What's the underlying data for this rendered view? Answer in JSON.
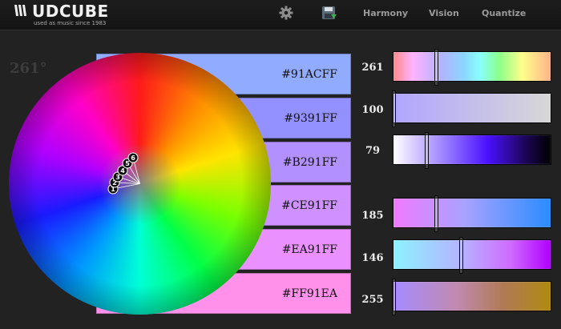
{
  "app": {
    "logo_text": "UDCUBE",
    "tagline": "used as music since 1983"
  },
  "nav": {
    "harmony": "Harmony",
    "vision": "Vision",
    "quantize": "Quantize"
  },
  "icons": {
    "settings": "gear-icon",
    "save": "save-icon"
  },
  "hue_readout": "261°",
  "swatches": [
    {
      "label": "#91ACFF",
      "color": "#91ACFF"
    },
    {
      "label": "#9391FF",
      "color": "#9391FF"
    },
    {
      "label": "#B291FF",
      "color": "#B291FF"
    },
    {
      "label": "#CE91FF",
      "color": "#CE91FF"
    },
    {
      "label": "#EA91FF",
      "color": "#EA91FF"
    },
    {
      "label": "#FF91EA",
      "color": "#FF91EA"
    }
  ],
  "wheel_markers": [
    "1",
    "2",
    "3",
    "4",
    "5",
    "6"
  ],
  "sliders": [
    {
      "value": "261",
      "level": 0.27
    },
    {
      "value": "100",
      "level": 0.0
    },
    {
      "value": "79",
      "level": 0.21
    },
    {
      "value": "185",
      "level": 0.27
    },
    {
      "value": "146",
      "level": 0.43
    },
    {
      "value": "255",
      "level": 0.0
    }
  ]
}
